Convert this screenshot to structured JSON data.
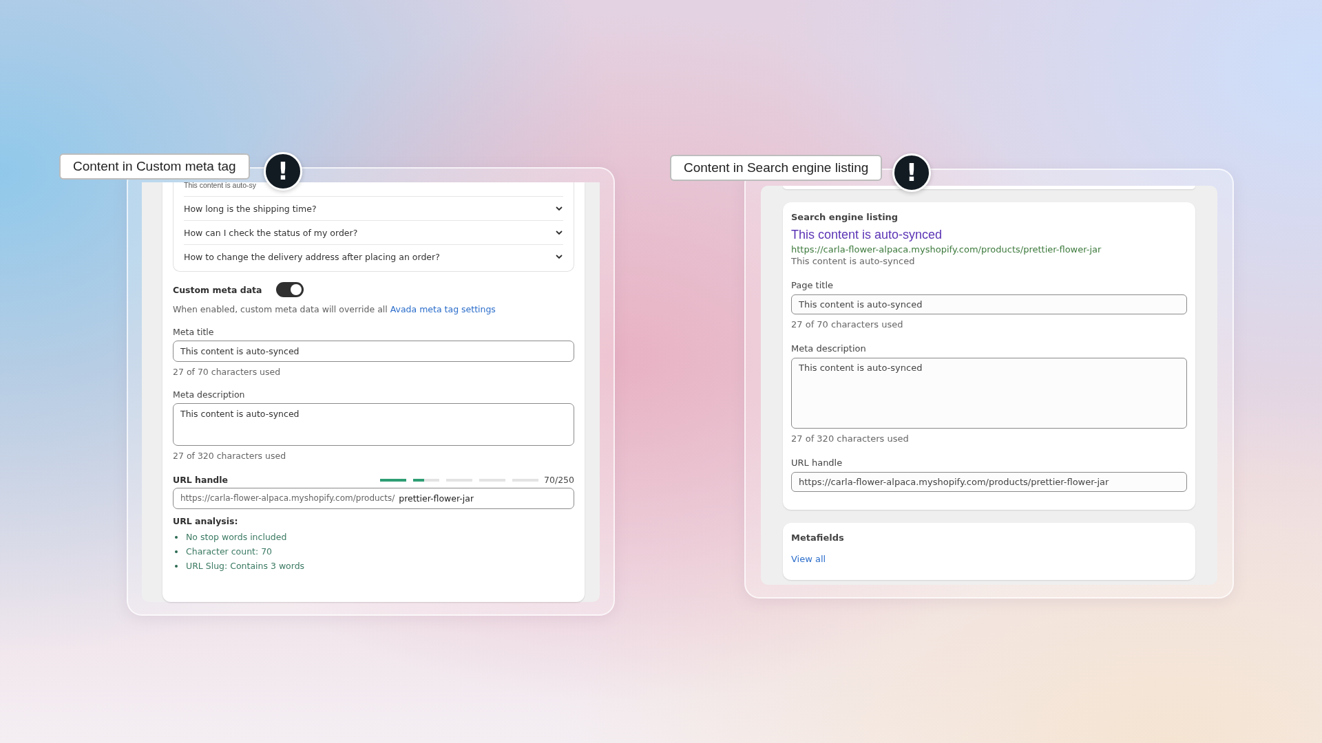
{
  "panels": [
    {
      "kind": "custom_meta",
      "tag": "Content in Custom meta tag",
      "alert": "!",
      "faq": {
        "cut_text": "This content is auto-sy",
        "questions": [
          "How long is the shipping time?",
          "How can I check the status of my order?",
          "How to change the delivery address after placing an order?"
        ]
      },
      "toggle": {
        "label": "Custom meta data",
        "on": true
      },
      "help": {
        "text": "When enabled, custom meta data will override all ",
        "link": "Avada meta tag settings"
      },
      "meta_title": {
        "label": "Meta title",
        "value": "This content is auto-synced",
        "count": "27 of 70 characters used"
      },
      "meta_description": {
        "label": "Meta description",
        "value": "This content is auto-synced",
        "count": "27 of 320 characters used"
      },
      "url_handle": {
        "label": "URL handle",
        "level": 0.28,
        "reading": "70/250",
        "prefix": "https://carla-flower-alpaca.myshopify.com/products/",
        "value": "prettier-flower-jar"
      },
      "url_analysis": {
        "title": "URL analysis:",
        "items": [
          "No stop words included",
          "Character count: 70",
          "URL Slug: Contains 3 words"
        ]
      }
    },
    {
      "kind": "search_listing",
      "tag": "Content in Search engine listing",
      "alert": "!",
      "listing": {
        "heading": "Search engine listing",
        "preview_title": "This content is auto-synced",
        "preview_url": "https://carla-flower-alpaca.myshopify.com/products/prettier-flower-jar",
        "preview_description": "This content is auto-synced"
      },
      "page_title": {
        "label": "Page title",
        "value": "This content is auto-synced",
        "count": "27 of 70 characters used"
      },
      "meta_description": {
        "label": "Meta description",
        "value": "This content is auto-synced",
        "count": "27 of 320 characters used"
      },
      "url_handle": {
        "label": "URL handle",
        "value": "https://carla-flower-alpaca.myshopify.com/products/prettier-flower-jar"
      },
      "metafields": {
        "heading": "Metafields",
        "link": "View all"
      }
    }
  ]
}
